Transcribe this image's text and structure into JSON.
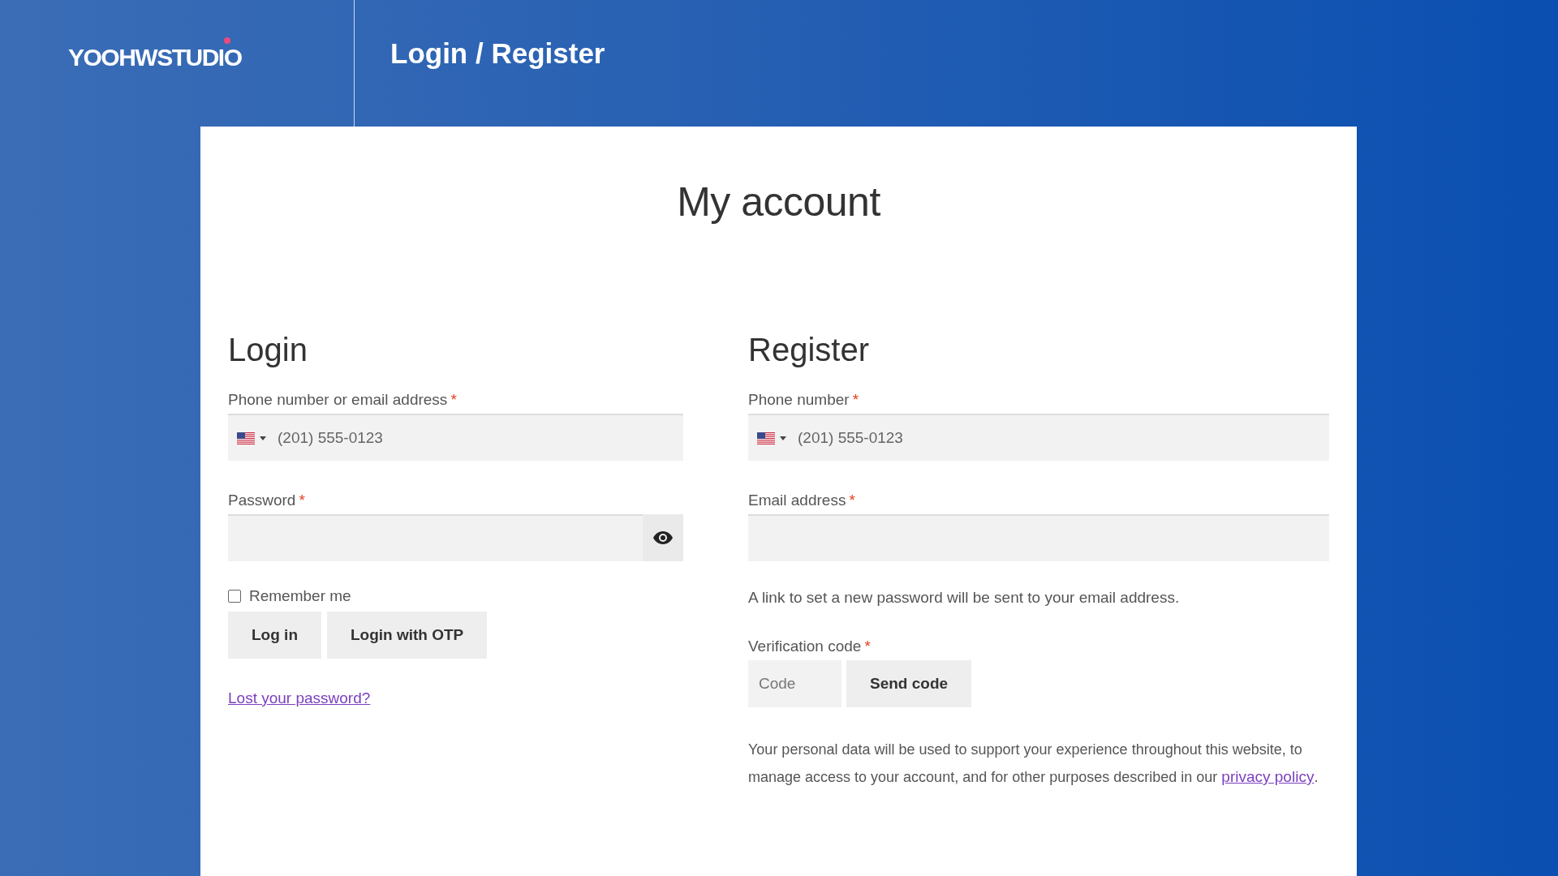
{
  "header": {
    "logo": "YOOHWSTUDIO",
    "title": "Login / Register"
  },
  "page_title": "My account",
  "login": {
    "heading": "Login",
    "fields": [
      {
        "kind": "phone",
        "label": "Phone number or email address",
        "required_mark": "*",
        "placeholder": "(201) 555-0123"
      },
      {
        "kind": "password",
        "label": "Password",
        "required_mark": "*"
      }
    ],
    "remember": {
      "label": "Remember me",
      "checked": false
    },
    "buttons": [
      "Log in",
      "Login with OTP"
    ],
    "lost_password": "Lost your password?"
  },
  "register": {
    "heading": "Register",
    "fields": [
      {
        "kind": "phone",
        "label": "Phone number",
        "required_mark": "*",
        "placeholder": "(201) 555-0123"
      },
      {
        "kind": "text",
        "label": "Email address",
        "required_mark": "*"
      }
    ],
    "note": "A link to set a new password will be sent to your email address.",
    "verification": {
      "label": "Verification code",
      "required_mark": "*",
      "placeholder": "Code",
      "button": "Send code"
    },
    "privacy": {
      "text_before": "Your personal data will be used to support your experience throughout this website, to manage access to your account, and for other purposes described in our ",
      "link": "privacy policy",
      "text_after": "."
    }
  }
}
